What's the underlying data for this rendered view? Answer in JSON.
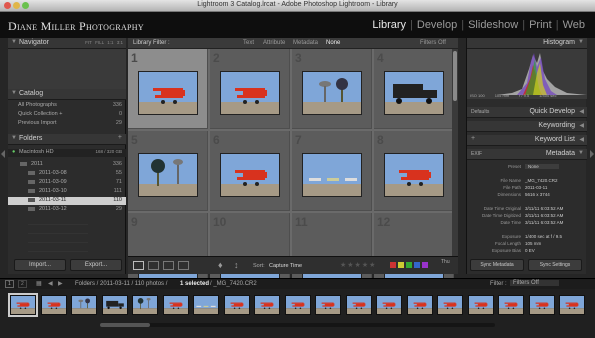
{
  "window": {
    "title": "Lightroom 3 Catalog.lrcat - Adobe Photoshop Lightroom - Library"
  },
  "identity": {
    "brand": "Diane Miller Photography",
    "modules": [
      "Library",
      "Develop",
      "Slideshow",
      "Print",
      "Web"
    ],
    "active_module": "Library"
  },
  "left_panel": {
    "navigator": {
      "title": "Navigator",
      "zoom_options": [
        "FIT",
        "FILL",
        "1:1",
        "3:1"
      ]
    },
    "catalog": {
      "title": "Catalog",
      "items": [
        {
          "label": "All Photographs",
          "count": "336"
        },
        {
          "label": "Quick Collection +",
          "count": "0"
        },
        {
          "label": "Previous Import",
          "count": "29"
        }
      ]
    },
    "folders": {
      "title": "Folders",
      "volume": {
        "name": "Macintosh HD",
        "space": "168 / 320 GB"
      },
      "items": [
        {
          "label": "2011",
          "count": "336"
        },
        {
          "label": "2011-03-08",
          "count": "55"
        },
        {
          "label": "2011-03-09",
          "count": "71"
        },
        {
          "label": "2011-03-10",
          "count": "111"
        },
        {
          "label": "2011-03-11",
          "count": "110"
        },
        {
          "label": "2011-03-12",
          "count": "29"
        }
      ],
      "selected_index": 4
    },
    "import_label": "Import...",
    "export_label": "Export..."
  },
  "library_filter": {
    "title": "Library Filter :",
    "options": [
      "Text",
      "Attribute",
      "Metadata",
      "None"
    ],
    "active": "None",
    "filters_state": "Filters Off"
  },
  "grid": {
    "cells": [
      {
        "num": "1",
        "thumb": "red-biplane-a",
        "selected": true
      },
      {
        "num": "2",
        "thumb": "red-biplane-b",
        "selected": false
      },
      {
        "num": "3",
        "thumb": "water-tower",
        "selected": false
      },
      {
        "num": "4",
        "thumb": "vintage-truck",
        "selected": false
      },
      {
        "num": "5",
        "thumb": "palm-tower",
        "selected": false
      },
      {
        "num": "6",
        "thumb": "red-biplane-c",
        "selected": false
      },
      {
        "num": "7",
        "thumb": "planes-field",
        "selected": false
      },
      {
        "num": "8",
        "thumb": "red-biplane-d",
        "selected": false
      },
      {
        "num": "9",
        "thumb": "partial",
        "selected": false
      },
      {
        "num": "10",
        "thumb": "partial",
        "selected": false
      },
      {
        "num": "11",
        "thumb": "partial",
        "selected": false
      },
      {
        "num": "12",
        "thumb": "partial",
        "selected": false
      }
    ]
  },
  "toolbar": {
    "sort_label": "Sort:",
    "sort_value": "Capture Time",
    "thumbnails_label": "Thu"
  },
  "right_panel": {
    "histogram": {
      "title": "Histogram",
      "iso": "ISO 100",
      "focal": "105 mm",
      "aperture": "f / 9.5",
      "shutter": "1/400 sec"
    },
    "quick_develop": {
      "title": "Quick Develop",
      "preset": "Defaults"
    },
    "keywording": {
      "title": "Keywording"
    },
    "keyword_list": {
      "title": "Keyword List"
    },
    "metadata": {
      "title": "Metadata",
      "preset_label": "Preset",
      "preset_value": "None",
      "view": "EXIF",
      "rows": [
        {
          "k": "File Name",
          "v": "_MG_7420.CR2"
        },
        {
          "k": "File Path",
          "v": "2011-03-11"
        },
        {
          "k": "Dimensions",
          "v": "5616 x 3744"
        },
        {
          "k": "",
          "v": ""
        },
        {
          "k": "Date Time Original",
          "v": "3/11/11 6:03:52 AM"
        },
        {
          "k": "Date Time Digitized",
          "v": "3/11/11 6:03:52 AM"
        },
        {
          "k": "Date Time",
          "v": "3/11/11 6:03:52 AM"
        },
        {
          "k": "",
          "v": ""
        },
        {
          "k": "Exposure",
          "v": "1/400 sec at f / 9.5"
        },
        {
          "k": "Focal Length",
          "v": "105 mm"
        },
        {
          "k": "Exposure Bias",
          "v": "0 EV"
        }
      ]
    },
    "sync_metadata_label": "Sync Metadata",
    "sync_settings_label": "Sync Settings"
  },
  "filmstrip_header": {
    "pages": [
      "1",
      "2"
    ],
    "path_prefix": "Folders / 2011-03-11 / 110 photos /",
    "selected_text": "1 selected",
    "file_suffix": "/ _MG_7420.CR2",
    "filter_label": "Filter :",
    "filter_value": "Filters Off"
  },
  "filmstrip": {
    "thumbs": [
      "red-biplane-a",
      "red-biplane-b",
      "water-tower",
      "vintage-truck",
      "palm-tower",
      "red-biplane-c",
      "planes-field",
      "red-biplane-d",
      "red-biplane-e",
      "red-biplane-f",
      "red-biplane-g",
      "red-biplane-h",
      "red-biplane-i",
      "red-biplane-j",
      "red-biplane-k",
      "red-biplane-l",
      "red-biplane-m",
      "red-biplane-n",
      "red-biplane-o"
    ]
  },
  "colors": {
    "accent_red": "#d8321e",
    "sky": "#7fa6d8",
    "ground": "#a69a86",
    "panel": "#2c2c2c"
  }
}
